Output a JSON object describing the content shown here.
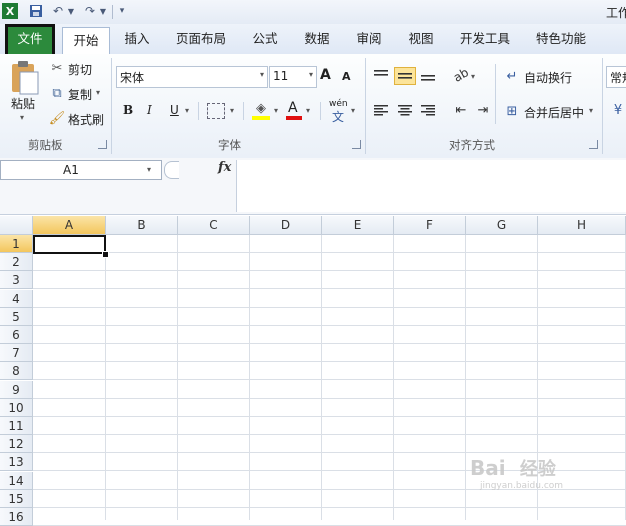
{
  "title": "工作",
  "qat": {
    "save_icon": "save-icon",
    "undo_icon": "undo-icon",
    "redo_icon": "redo-icon",
    "customize_icon": "customize-icon"
  },
  "tabs": [
    "文件",
    "开始",
    "插入",
    "页面布局",
    "公式",
    "数据",
    "审阅",
    "视图",
    "开发工具",
    "特色功能"
  ],
  "clipboard": {
    "paste": "粘贴",
    "cut": "剪切",
    "copy": "复制",
    "format_painter": "格式刷",
    "label": "剪贴板"
  },
  "font": {
    "name": "宋体",
    "size": "11",
    "bold": "B",
    "italic": "I",
    "underline": "U",
    "grow": "A",
    "shrink": "A",
    "font_color": "A",
    "phonetic": "wén",
    "phonetic2": "文",
    "label": "字体"
  },
  "alignment": {
    "wrap": "自动换行",
    "merge": "合并后居中",
    "label": "对齐方式"
  },
  "number": {
    "format": "常规"
  },
  "namebox": {
    "value": "A1"
  },
  "fx": "fx",
  "columns": [
    "A",
    "B",
    "C",
    "D",
    "E",
    "F",
    "G",
    "H"
  ],
  "rows": [
    "1",
    "2",
    "3",
    "4",
    "5",
    "6",
    "7",
    "8",
    "9",
    "10",
    "11",
    "12",
    "13",
    "14",
    "15",
    "16"
  ],
  "watermark": {
    "line1": "Bai",
    "line2": "经验",
    "line3": "jingyan.baidu.com"
  },
  "colors": {
    "file_tab": "#2c8a3c",
    "selection": "#f3c65d",
    "font_color_bar": "#e01010",
    "highlight_bar": "#ffff00"
  }
}
